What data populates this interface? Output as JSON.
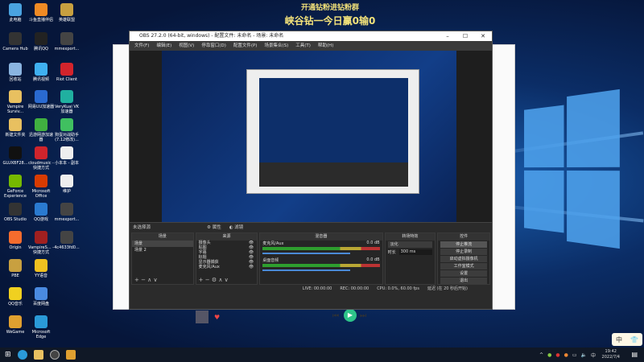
{
  "banner": {
    "line1": "开通钻粉进钻粉群",
    "line2": "峡谷钻一今日赢0输0"
  },
  "desktop_icons": [
    {
      "label": "此电脑",
      "color": "#4aa3e0"
    },
    {
      "label": "斗鱼直播伴侣",
      "color": "#f08a24"
    },
    {
      "label": "英雄联盟",
      "color": "#c8a040"
    },
    {
      "label": "Camera Hub",
      "color": "#333"
    },
    {
      "label": "腾讯QQ",
      "color": "#222"
    },
    {
      "label": "mmexport...",
      "color": "#444"
    },
    {
      "label": "回收站",
      "color": "#8ab4e0"
    },
    {
      "label": "腾讯视频",
      "color": "#3fb0f0"
    },
    {
      "label": "Riot Client",
      "color": "#d3242c"
    },
    {
      "label": "Vampire Surviv...",
      "color": "#e8c060"
    },
    {
      "label": "网易UU加速器",
      "color": "#2a6ad0"
    },
    {
      "label": "VeryKuai VK加速器",
      "color": "#20b0a0"
    },
    {
      "label": "新建文件夹",
      "color": "#e8c060"
    },
    {
      "label": "迅游网游加速器",
      "color": "#40b040"
    },
    {
      "label": "狗蛋对战助手(7.12修改)...",
      "color": "#40c060"
    },
    {
      "label": "GLUXBF28...",
      "color": "#111"
    },
    {
      "label": "cloudmusic - 快捷方式",
      "color": "#d0242c"
    },
    {
      "label": "小本本 - 副本",
      "color": "#eee"
    },
    {
      "label": "GeForce Experience",
      "color": "#76b900"
    },
    {
      "label": "Microsoft Office",
      "color": "#d83b01"
    },
    {
      "label": "维护",
      "color": "#eee"
    },
    {
      "label": "OBS Studio",
      "color": "#333"
    },
    {
      "label": "QQ游戏",
      "color": "#2a7ad0"
    },
    {
      "label": "mmexport...",
      "color": "#444"
    },
    {
      "label": "Origin",
      "color": "#f56c2d"
    },
    {
      "label": "VampireS... - 快捷方式",
      "color": "#a02020"
    },
    {
      "label": "4c4633fd0...",
      "color": "#444"
    },
    {
      "label": "PBE",
      "color": "#c8a040"
    },
    {
      "label": "YY语音",
      "color": "#f0c020"
    },
    {
      "label": "QQ音乐",
      "color": "#f0d020"
    },
    {
      "label": "百度网盘",
      "color": "#4a8ae0"
    },
    {
      "label": "WeGame",
      "color": "#e0a030"
    },
    {
      "label": "Microsoft Edge",
      "color": "#2a9ad8"
    }
  ],
  "obs": {
    "title": "OBS 27.2.0 (64-bit, windows) - 配置文件: 未命名 - 场景: 未命名",
    "menu": [
      "文件(F)",
      "编辑(E)",
      "视图(V)",
      "停靠窗口(D)",
      "配置文件(P)",
      "场景集合(S)",
      "工具(T)",
      "帮助(H)"
    ],
    "no_source": "未选择源",
    "properties": "属性",
    "filters": "滤镜",
    "scenes": {
      "title": "场景",
      "items": [
        "场景",
        "场景 2"
      ]
    },
    "sources": {
      "title": "来源",
      "items": [
        "摄像头",
        "贴图",
        "字幕",
        "标题",
        "显示器捕获",
        "麦克风/Aux"
      ]
    },
    "mixer": {
      "title": "混音器",
      "channels": [
        {
          "name": "麦克风/Aux",
          "db": "0.0 dB"
        },
        {
          "name": "桌面音频",
          "db": "0.0 dB"
        }
      ]
    },
    "transitions": {
      "title": "转场特效",
      "type": "淡化",
      "duration_label": "时长",
      "duration": "300 ms"
    },
    "controls": {
      "title": "控件",
      "buttons": [
        "停止推流",
        "停止录制",
        "启动虚拟摄像机",
        "工作室模式",
        "设置",
        "退出"
      ]
    },
    "status": {
      "live": "LIVE: 00:00:00",
      "rec": "REC: 00:00:00",
      "cpu": "CPU: 0.0%, 60.00 fps",
      "delay": "延迟 (在 20 秒后开始)"
    }
  },
  "taskbar": {
    "time": "19:42",
    "date": "2022/7/4"
  },
  "ime": {
    "mode": "中"
  }
}
